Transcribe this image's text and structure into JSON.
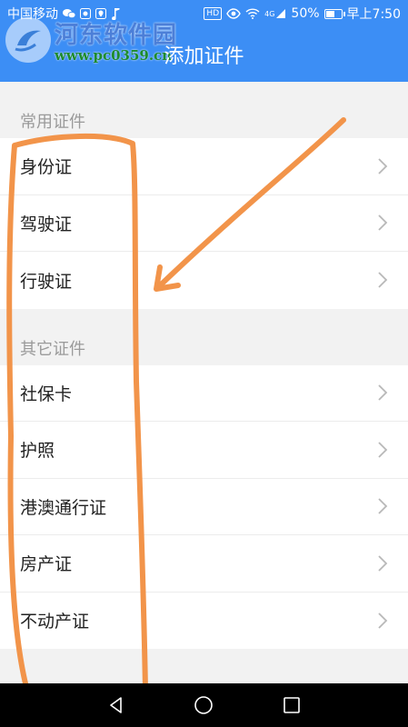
{
  "status_bar": {
    "carrier": "中国移动",
    "hd_badge": "HD",
    "network": "4G",
    "battery_percent": "50%",
    "battery_level": 0.5,
    "time": "早上7:50"
  },
  "watermark": {
    "name": "河东软件园",
    "url": "www.pc0359.cn"
  },
  "header": {
    "title": "添加证件",
    "background_color": "#3c8ef5"
  },
  "sections": [
    {
      "label": "常用证件",
      "items": [
        "身份证",
        "驾驶证",
        "行驶证"
      ]
    },
    {
      "label": "其它证件",
      "items": [
        "社保卡",
        "护照",
        "港澳通行证",
        "房产证",
        "不动产证"
      ]
    }
  ],
  "colors": {
    "annotation": "#f2944a",
    "section_label": "#9a9a9a",
    "chevron": "#b8b8b8"
  }
}
